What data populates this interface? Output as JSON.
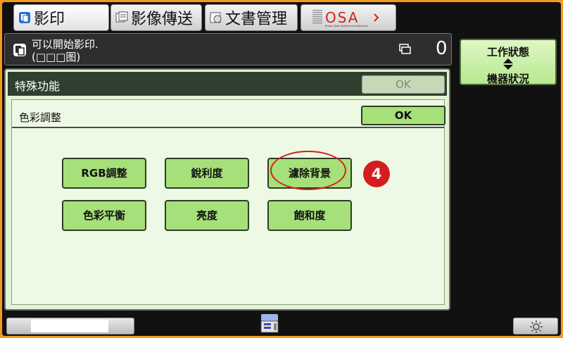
{
  "tabs": [
    {
      "label": "影印",
      "active": true
    },
    {
      "label": "影像傳送",
      "active": false
    },
    {
      "label": "文書管理",
      "active": false
    }
  ],
  "osa_tab": {
    "logo_text": "OSA",
    "logo_subtext": "Sharp Open Systems Architecture"
  },
  "status": {
    "line1": "可以開始影印.",
    "line2": "(□□□图)",
    "copy_count": "0"
  },
  "side": {
    "job_status_line1": "工作狀態",
    "job_status_line2": "機器狀況"
  },
  "panel": {
    "title": "特殊功能",
    "ok_label": "OK",
    "sub": {
      "title": "色彩調整",
      "ok_label": "OK",
      "buttons": [
        {
          "label": "RGB調整"
        },
        {
          "label": "銳利度"
        },
        {
          "label": "濾除背景"
        },
        {
          "label": "色彩平衡"
        },
        {
          "label": "亮度"
        },
        {
          "label": "飽和度"
        }
      ]
    }
  },
  "annotation": {
    "step_number": "4",
    "color": "#d51d1d"
  },
  "colors": {
    "frame_orange": "#f39a1e",
    "button_green": "#a6e07a",
    "panel_bg": "#e3f4d4",
    "header_dark": "#2f3f2f"
  },
  "icons": {
    "copy_tab": "copy-icon",
    "send_tab": "image-send-icon",
    "filing_tab": "document-filing-icon",
    "status": "copier-icon",
    "counter": "copy-stack-icon",
    "job_status": "up-down-arrows-icon",
    "device": "machine-icon",
    "brightness": "sun-icon"
  }
}
